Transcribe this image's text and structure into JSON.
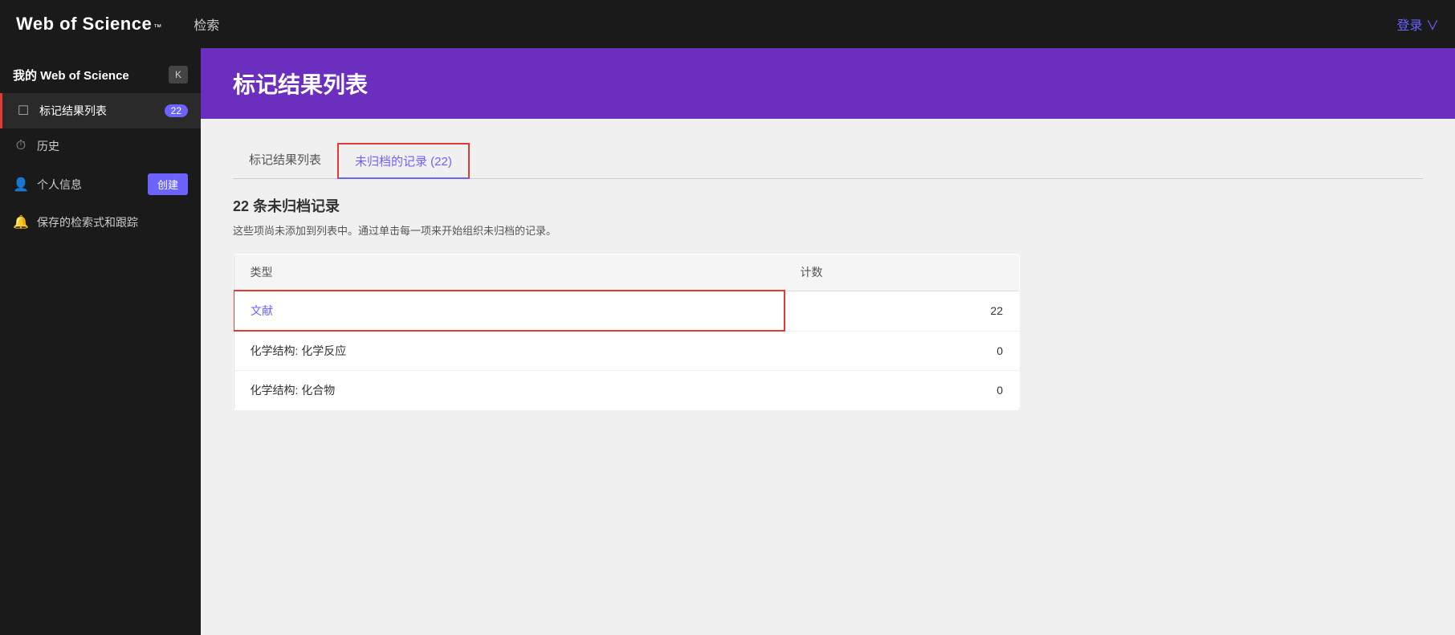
{
  "topNav": {
    "logo": "Web of Science",
    "logoTm": "™",
    "searchLabel": "检索",
    "loginLabel": "登录 ∨"
  },
  "sidebar": {
    "headerTitle": "我的 Web of Science",
    "collapseBtn": "K",
    "items": [
      {
        "id": "marked-list",
        "icon": "☐",
        "label": "标记结果列表",
        "badge": "22",
        "active": true
      },
      {
        "id": "history",
        "icon": "⏱",
        "label": "历史",
        "badge": null,
        "active": false
      },
      {
        "id": "profile",
        "icon": "👤",
        "label": "个人信息",
        "badge": null,
        "active": false,
        "hasCreate": true,
        "createLabel": "创建"
      },
      {
        "id": "saved-searches",
        "icon": "🔔",
        "label": "保存的检索式和跟踪",
        "badge": null,
        "active": false
      }
    ]
  },
  "page": {
    "headerTitle": "标记结果列表",
    "tabs": [
      {
        "id": "marked-list-tab",
        "label": "标记结果列表",
        "active": false
      },
      {
        "id": "unarchived-tab",
        "label": "未归档的记录 (22)",
        "active": true
      }
    ],
    "unarchivedSection": {
      "title": "22 条未归档记录",
      "description": "这些项尚未添加到列表中。通过单击每一项来开始组织未归档的记录。"
    },
    "tableHeaders": {
      "type": "类型",
      "count": "计数"
    },
    "tableRows": [
      {
        "type": "文献",
        "count": "22",
        "isLink": true,
        "highlighted": true
      },
      {
        "type": "化学结构: 化学反应",
        "count": "0",
        "isLink": false,
        "highlighted": false
      },
      {
        "type": "化学结构: 化合物",
        "count": "0",
        "isLink": false,
        "highlighted": false
      }
    ]
  }
}
